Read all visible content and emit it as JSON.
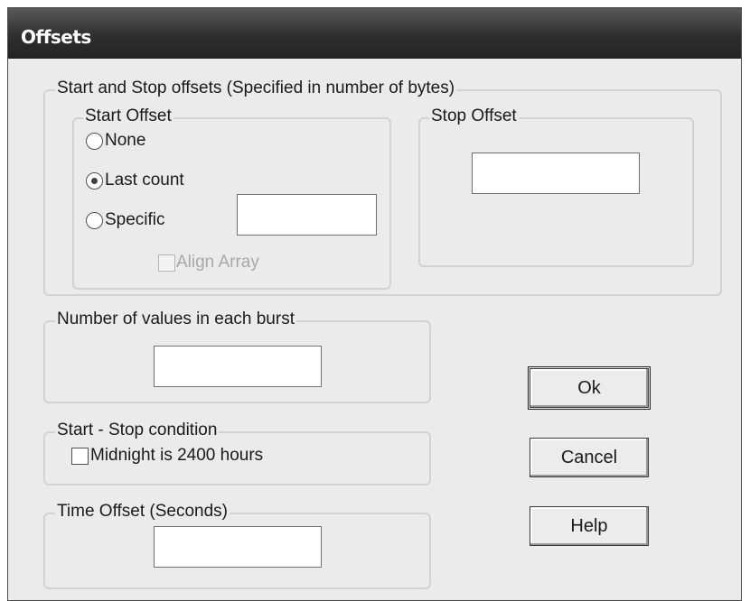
{
  "window": {
    "title": "Offsets"
  },
  "offsets_group": {
    "label": "Start and Stop offsets (Specified in number of bytes)",
    "start_offset": {
      "label": "Start Offset",
      "options": [
        "None",
        "Last count",
        "Specific"
      ],
      "selected": "Last count",
      "specific_value": "",
      "align_array": {
        "label": "Align Array",
        "checked": false,
        "enabled": false
      }
    },
    "stop_offset": {
      "label": "Stop Offset",
      "value": ""
    }
  },
  "burst_group": {
    "label": "Number of values in each burst",
    "value": ""
  },
  "condition_group": {
    "label": "Start - Stop condition",
    "midnight": {
      "label": "Midnight is 2400 hours",
      "checked": false
    }
  },
  "time_offset_group": {
    "label": "Time Offset (Seconds)",
    "value": ""
  },
  "buttons": {
    "ok": "Ok",
    "cancel": "Cancel",
    "help": "Help"
  }
}
